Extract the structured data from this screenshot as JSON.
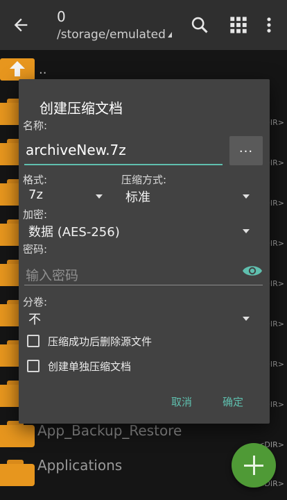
{
  "appbar": {
    "title": "0",
    "path": "/storage/emulated",
    "icons": [
      "back-arrow-icon",
      "search-icon",
      "grid-view-icon",
      "more-vert-icon"
    ]
  },
  "list": {
    "up_label": "..",
    "dir_tag": "<DIR>",
    "visible_names": [
      "App_Backup_Restore",
      "Applications"
    ]
  },
  "dialog": {
    "title": "创建压缩文档",
    "name_label": "名称:",
    "name_value": "archiveNew.7z",
    "browse_label": "...",
    "format_label": "格式:",
    "format_value": "7z",
    "compression_label": "压缩方式:",
    "compression_value": "标准",
    "encryption_label": "加密:",
    "encryption_value": "数据 (AES-256)",
    "password_label": "密码:",
    "password_placeholder": "输入密码",
    "split_label": "分卷:",
    "split_value": "不",
    "delete_source_label": "压缩成功后删除源文件",
    "separate_archives_label": "创建单独压缩文档",
    "cancel_label": "取消",
    "ok_label": "确定"
  },
  "colors": {
    "accent": "#5fbfae",
    "folder": "#e7961e",
    "fab": "#4f9a36",
    "dialog_bg": "#424242"
  }
}
